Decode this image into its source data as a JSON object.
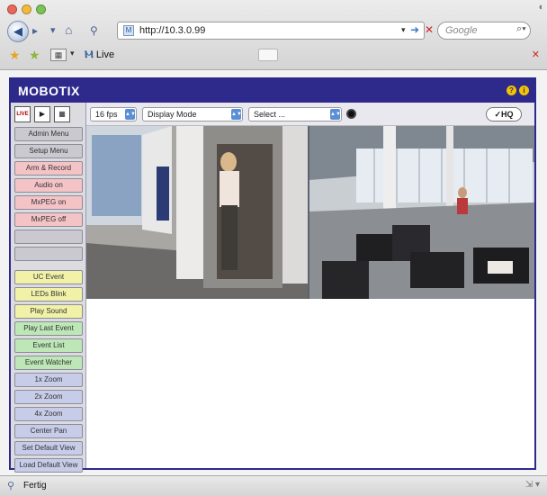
{
  "browser": {
    "url": "http://10.3.0.99",
    "search_placeholder": "Google",
    "tab_title": "Live",
    "status": "Fertig"
  },
  "app": {
    "logo": "MOBOTIX"
  },
  "toolbar": {
    "fps": "16 fps",
    "display_mode": "Display Mode",
    "select": "Select ...",
    "hq_label": "HQ"
  },
  "sidebar": {
    "view_icons": [
      "LIVE",
      "play",
      "grid"
    ],
    "buttons": [
      {
        "label": "Admin Menu",
        "color": "#c9c9cf"
      },
      {
        "label": "Setup Menu",
        "color": "#c9c9cf"
      },
      {
        "label": "Arm & Record",
        "color": "#f4c3c6"
      },
      {
        "label": "Audio on",
        "color": "#f4c3c6"
      },
      {
        "label": "MxPEG on",
        "color": "#f4c3c6"
      },
      {
        "label": "MxPEG off",
        "color": "#f4c3c6"
      },
      {
        "label": "",
        "color": "#c9c9cf"
      },
      {
        "label": "",
        "color": "#c9c9cf"
      },
      {
        "label": "UC Event",
        "color": "#f1f2a8"
      },
      {
        "label": "LEDs Blink",
        "color": "#f1f2a8"
      },
      {
        "label": "Play Sound",
        "color": "#f1f2a8"
      },
      {
        "label": "Play Last Event",
        "color": "#bde7b6"
      },
      {
        "label": "Event List",
        "color": "#bde7b6"
      },
      {
        "label": "Event Watcher",
        "color": "#bde7b6"
      },
      {
        "label": "1x Zoom",
        "color": "#c7cce9"
      },
      {
        "label": "2x Zoom",
        "color": "#c7cce9"
      },
      {
        "label": "4x Zoom",
        "color": "#c7cce9"
      },
      {
        "label": "Center Pan",
        "color": "#c7cce9"
      },
      {
        "label": "Set Default View",
        "color": "#c7cce9"
      },
      {
        "label": "Load Default View",
        "color": "#c7cce9"
      },
      {
        "label": "",
        "color": "#f1f2a8"
      }
    ]
  },
  "colors": {
    "brand": "#2e2a8c",
    "hdr_icon": "#f2c400"
  },
  "icons": [
    "safari-back-icon",
    "forward-icon",
    "home-icon",
    "rss-icon",
    "favicon",
    "go-icon",
    "stop-icon",
    "search-icon",
    "bookmark-star-icon",
    "grid-icon",
    "mobotix-tab-icon",
    "close-icon",
    "help-icon",
    "info-icon",
    "gear-icon",
    "hq-icon"
  ]
}
